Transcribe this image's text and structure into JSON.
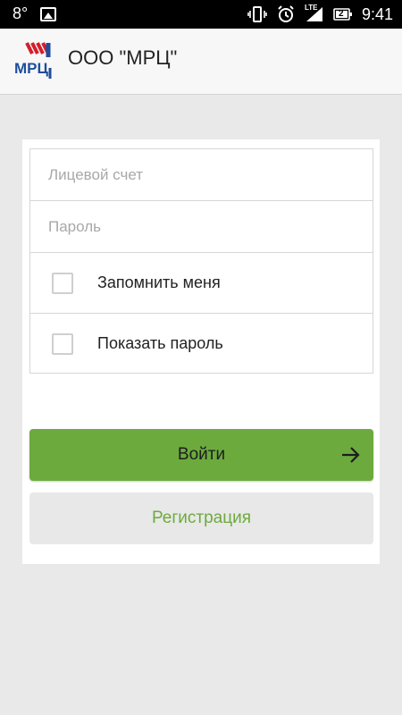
{
  "status_bar": {
    "temperature": "8°",
    "time": "9:41",
    "network_badge": "LTE",
    "sim_badge": "2",
    "icons": [
      "image-icon",
      "vibrate-icon",
      "alarm-icon",
      "signal-icon",
      "battery-icon"
    ]
  },
  "app_bar": {
    "title": "ООО \"МРЦ\"",
    "logo_text": "МРЦ"
  },
  "form": {
    "account_placeholder": "Лицевой счет",
    "account_value": "",
    "password_placeholder": "Пароль",
    "password_value": "",
    "remember_label": "Запомнить меня",
    "remember_checked": false,
    "show_password_label": "Показать пароль",
    "show_password_checked": false
  },
  "buttons": {
    "login_label": "Войти",
    "register_label": "Регистрация"
  },
  "colors": {
    "accent": "#6caa3e",
    "logo_red": "#d21e2b",
    "logo_blue": "#1f4e9c"
  }
}
